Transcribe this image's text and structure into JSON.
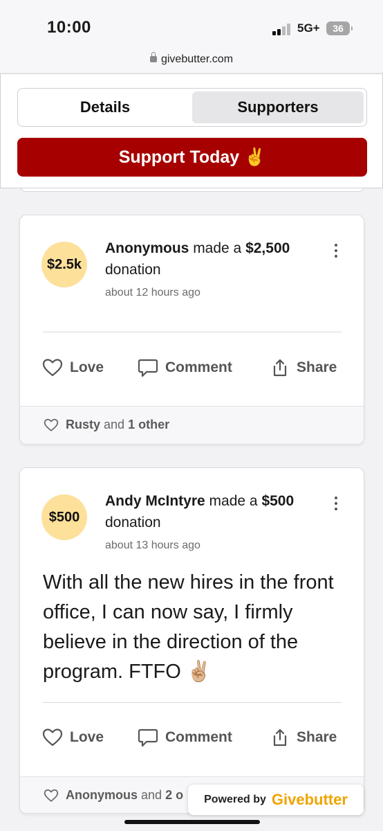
{
  "status": {
    "time": "10:00",
    "network": "5G+",
    "battery": "36"
  },
  "browser": {
    "url": "givebutter.com"
  },
  "tabs": {
    "details": "Details",
    "supporters": "Supporters"
  },
  "cta": {
    "label": "Support Today",
    "emoji": "✌️"
  },
  "posts": [
    {
      "avatar": "$2.5k",
      "name": "Anonymous",
      "made": "made a",
      "amount": "$2,500",
      "donation": "donation",
      "time": "about 12 hours ago",
      "message": "",
      "actions": {
        "love": "Love",
        "comment": "Comment",
        "share": "Share"
      },
      "footer": {
        "name": "Rusty",
        "and": "and",
        "others": "1 other"
      }
    },
    {
      "avatar": "$500",
      "name": "Andy McIntyre",
      "made": "made a",
      "amount": "$500",
      "donation": "donation",
      "time": "about 13 hours ago",
      "message": "With all the new hires in the front office, I can now say, I firmly believe in the direction of the program. FTFO ✌🏼",
      "actions": {
        "love": "Love",
        "comment": "Comment",
        "share": "Share"
      },
      "footer": {
        "name": "Anonymous",
        "and": "and",
        "others": "2 o"
      }
    }
  ],
  "powered": {
    "prefix": "Powered by",
    "brand": "Givebutter"
  },
  "colors": {
    "accent": "#a60000",
    "avatar": "#fde09a",
    "brand": "#f0a400"
  },
  "icons": [
    "signal-icon",
    "battery-icon",
    "lock-icon",
    "kebab-menu-icon",
    "heart-icon",
    "comment-icon",
    "share-icon"
  ]
}
